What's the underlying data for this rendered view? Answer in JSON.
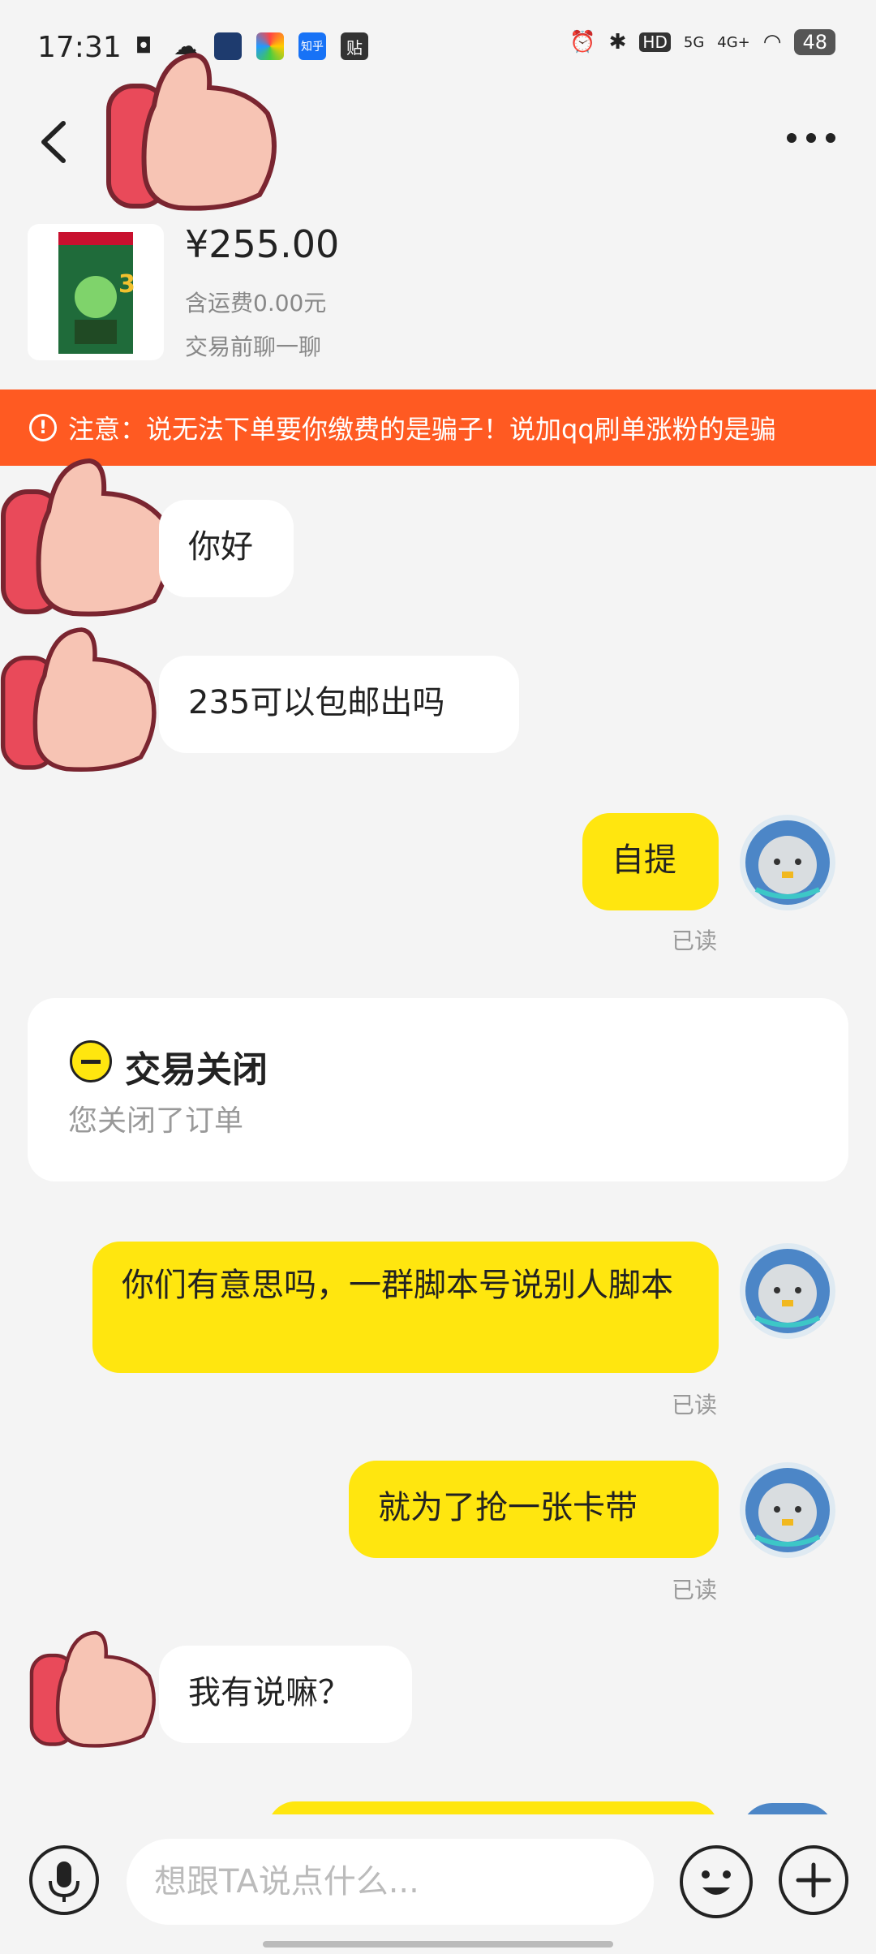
{
  "status_bar": {
    "time": "17:31",
    "app_icon_label": "贴",
    "zhihu_label": "知乎",
    "hd_label": "HD",
    "network_5g": "5G",
    "network_4g": "4G+",
    "battery": "48"
  },
  "product": {
    "price": "¥255.00",
    "shipping": "含运费0.00元",
    "chat_hint": "交易前聊一聊",
    "thumb_title": "Luigi's Mansion 3"
  },
  "notice": {
    "text": "注意：说无法下单要你缴费的是骗子！说加qq刷单涨粉的是骗"
  },
  "messages": [
    {
      "side": "in",
      "text": "你好"
    },
    {
      "side": "in",
      "text": "235可以包邮出吗"
    },
    {
      "side": "out",
      "text": "自提",
      "status": "已读"
    },
    {
      "side": "out",
      "text": "你们有意思吗，一群脚本号说别人脚本",
      "status": "已读"
    },
    {
      "side": "out",
      "text": "就为了抢一张卡带",
      "status": "已读"
    },
    {
      "side": "in",
      "text": "我有说嘛？"
    }
  ],
  "order_card": {
    "title": "交易关闭",
    "subtitle": "您关闭了订单"
  },
  "input": {
    "placeholder": "想跟TA说点什么..."
  },
  "colors": {
    "accent_yellow": "#ffe60f",
    "notice_orange": "#ff5a22",
    "background": "#f4f4f4"
  }
}
